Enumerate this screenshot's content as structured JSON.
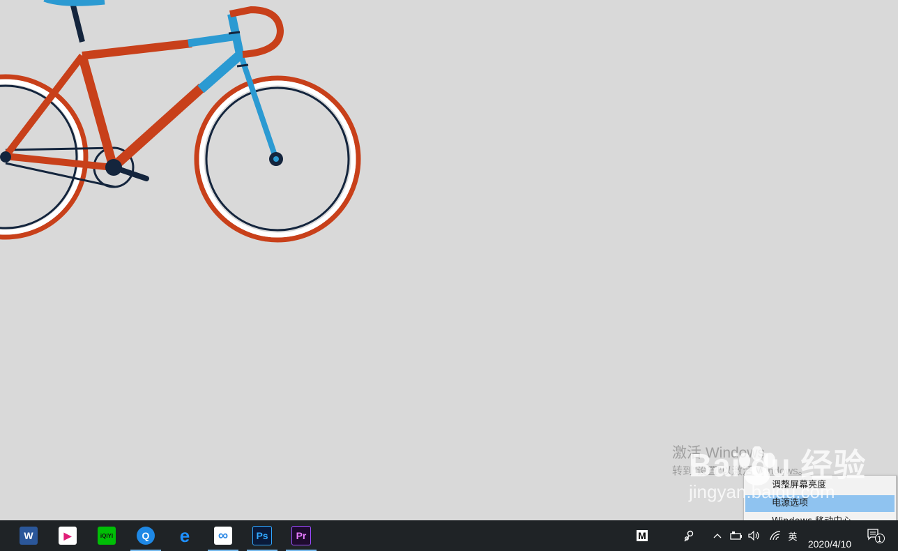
{
  "watermark": {
    "activate_title": "激活 Windows",
    "activate_sub": "转到\"设置\"以激活 Windows。"
  },
  "context_menu": {
    "items": [
      {
        "label": "调整屏幕亮度",
        "highlighted": false
      },
      {
        "label": "电源选项",
        "highlighted": true
      },
      {
        "label": "Windows 移动中心",
        "highlighted": false
      }
    ]
  },
  "baidu_watermark": {
    "logo_text": "Bai du 经验",
    "url": "jingyan.baidu.com"
  },
  "taskbar": {
    "apps": [
      {
        "name": "Word",
        "glyph": "W",
        "color": "#2b579a",
        "running": false
      },
      {
        "name": "Youku",
        "glyph": "▶",
        "color": "#ffffff",
        "running": false
      },
      {
        "name": "iQIYI",
        "glyph": "iQIYI",
        "color": "#00be06",
        "running": false
      },
      {
        "name": "QQ Browser",
        "glyph": "Q",
        "color": "#1e88e5",
        "running": true
      },
      {
        "name": "Edge",
        "glyph": "e",
        "color": "#1f2326",
        "running": false
      },
      {
        "name": "Baidu Netdisk",
        "glyph": "∞",
        "color": "#ffffff",
        "running": true
      },
      {
        "name": "Photoshop",
        "glyph": "Ps",
        "color": "#0a1a3a",
        "running": true
      },
      {
        "name": "Premiere",
        "glyph": "Pr",
        "color": "#1e0b2e",
        "running": true
      }
    ],
    "tray_m": "M",
    "ime": "英",
    "date": "2020/4/10",
    "notification_count": "1"
  }
}
